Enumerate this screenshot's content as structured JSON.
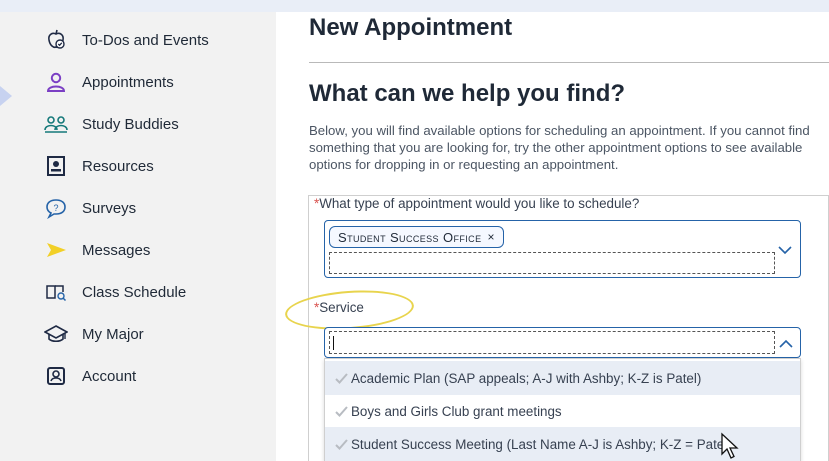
{
  "sidebar": {
    "items": [
      {
        "label": "To-Dos and Events",
        "icon": "todos-apple-icon"
      },
      {
        "label": "Appointments",
        "icon": "person-icon"
      },
      {
        "label": "Study Buddies",
        "icon": "people-icon"
      },
      {
        "label": "Resources",
        "icon": "id-card-icon"
      },
      {
        "label": "Surveys",
        "icon": "question-bubble-icon"
      },
      {
        "label": "Messages",
        "icon": "paper-plane-icon"
      },
      {
        "label": "Class Schedule",
        "icon": "book-icon"
      },
      {
        "label": "My Major",
        "icon": "graduation-cap-icon"
      },
      {
        "label": "Account",
        "icon": "account-icon"
      }
    ]
  },
  "main": {
    "page_title": "New Appointment",
    "section_title": "What can we help you find?",
    "intro": "Below, you will find available options for scheduling an appointment. If you cannot find something that you are looking for, try the other appointment options to see available options for dropping in or requesting an appointment.",
    "appointment_type": {
      "required_mark": "*",
      "label": "What type of appointment would you like to schedule?",
      "selected_chip": "Student Success Office",
      "remove_glyph": "×"
    },
    "service": {
      "required_mark": "*",
      "label": "Service",
      "input_value": "",
      "options": [
        "Academic Plan (SAP appeals; A-J with Ashby; K-Z is Patel)",
        "Boys and Girls Club grant meetings",
        "Student Success Meeting (Last Name A-J is Ashby; K-Z = Patel"
      ]
    }
  },
  "colors": {
    "accent_border": "#2563a8",
    "required": "#d9534f",
    "highlight_ring": "#e8d44d",
    "icon_purple": "#7b3fc4",
    "icon_yellow": "#f2d027",
    "icon_teal": "#15797a",
    "icon_navy": "#1f2a44"
  }
}
